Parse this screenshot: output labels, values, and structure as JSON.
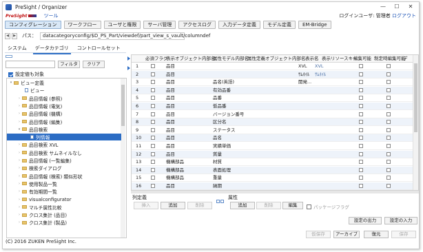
{
  "window": {
    "title": "PreSight / Organizer",
    "controls": [
      "—",
      "☐",
      "✕"
    ]
  },
  "menu": {
    "logo": "PreSight",
    "tools": "ツール",
    "login_prefix": "ログインユーザ: 管理者",
    "logout": "ログアウト"
  },
  "main_tabs": [
    "コンフィグレーション",
    "ワークフロー",
    "ユーザと権限",
    "サーバ管理",
    "アクセスログ",
    "入力データ定義",
    "モデル定義",
    "EM-Bridge"
  ],
  "path": {
    "label": "パス：",
    "value": "datacategoryconfig/$D_PS_Part/viewdef/part_view_s_vault/columndef"
  },
  "sub_tabs": [
    "システム",
    "データカテゴリ",
    "コントロールセット"
  ],
  "left": {
    "filter_label": "フィルタ",
    "clear_label": "クリア",
    "include_settings": "設定値も対象",
    "tree": [
      {
        "label": "ビュー定義",
        "type": "folder",
        "arrow": "▾"
      },
      {
        "label": "ビュー",
        "type": "file",
        "arrow": ""
      },
      {
        "label": "品目情報 (参照)",
        "type": "folder",
        "arrow": "›"
      },
      {
        "label": "品目情報 (電気)",
        "type": "folder",
        "arrow": "›"
      },
      {
        "label": "品目情報 (機構)",
        "type": "folder",
        "arrow": "›"
      },
      {
        "label": "品目情報 (編集)",
        "type": "folder",
        "arrow": "›"
      },
      {
        "label": "品目検索",
        "type": "folder",
        "arrow": "▾"
      },
      {
        "label": "列情報",
        "type": "file",
        "arrow": ""
      },
      {
        "label": "品目検索 XVL",
        "type": "folder",
        "arrow": "›"
      },
      {
        "label": "品目検索 サムネイルなし",
        "type": "folder",
        "arrow": "›"
      },
      {
        "label": "品目情報 (一覧編集)",
        "type": "folder",
        "arrow": "›"
      },
      {
        "label": "検索ダイアログ",
        "type": "folder",
        "arrow": "›"
      },
      {
        "label": "品目情報 (検索) 類似形状",
        "type": "folder",
        "arrow": "›"
      },
      {
        "label": "使用製品一覧",
        "type": "folder",
        "arrow": "›"
      },
      {
        "label": "有効期間一覧",
        "type": "folder",
        "arrow": "›"
      },
      {
        "label": "visualconfigurator",
        "type": "folder",
        "arrow": "›"
      },
      {
        "label": "マルチ属性比較",
        "type": "folder",
        "arrow": "›"
      },
      {
        "label": "クロス集計 (品目)",
        "type": "folder",
        "arrow": "›"
      },
      {
        "label": "クロス集計 (製品)",
        "type": "folder",
        "arrow": "›"
      }
    ],
    "selected_index": 7
  },
  "grid": {
    "headers": [
      "",
      "必須フラグ",
      "表示オブジェクト内部名",
      "属性モデル内部名",
      "属性定義オブジェクト内部名",
      "表示名",
      "表示リソースキー",
      "編集可能",
      "制定時編集可能",
      "デ"
    ],
    "rows": [
      {
        "n": "1",
        "obj": "品目",
        "attr": "",
        "name": "XVL",
        "res": "XVL"
      },
      {
        "n": "2",
        "obj": "品目",
        "attr": "",
        "name": "ｻﾑﾈｲﾙ",
        "res": "ｻﾑﾈｲﾙ"
      },
      {
        "n": "3",
        "obj": "品目",
        "attr": "品名(英語)",
        "name": "開発...",
        "res": ""
      },
      {
        "n": "4",
        "obj": "品目",
        "attr": "有効品番",
        "name": "",
        "res": ""
      },
      {
        "n": "5",
        "obj": "品目",
        "attr": "品番",
        "name": "",
        "res": ""
      },
      {
        "n": "6",
        "obj": "品目",
        "attr": "仮品番",
        "name": "",
        "res": ""
      },
      {
        "n": "7",
        "obj": "品目",
        "attr": "バージョン番号",
        "name": "",
        "res": ""
      },
      {
        "n": "8",
        "obj": "品目",
        "attr": "区分名",
        "name": "",
        "res": ""
      },
      {
        "n": "9",
        "obj": "品目",
        "attr": "ステータス",
        "name": "",
        "res": ""
      },
      {
        "n": "10",
        "obj": "品目",
        "attr": "品名",
        "name": "",
        "res": ""
      },
      {
        "n": "11",
        "obj": "品目",
        "attr": "実績単価",
        "name": "",
        "res": ""
      },
      {
        "n": "12",
        "obj": "品目",
        "attr": "質量",
        "name": "",
        "res": ""
      },
      {
        "n": "13",
        "obj": "機構部品",
        "attr": "材質",
        "name": "",
        "res": ""
      },
      {
        "n": "14",
        "obj": "機構部品",
        "attr": "表面処理",
        "name": "",
        "res": ""
      },
      {
        "n": "15",
        "obj": "機構部品",
        "attr": "重量",
        "name": "",
        "res": ""
      },
      {
        "n": "16",
        "obj": "品目",
        "attr": "納期",
        "name": "",
        "res": ""
      }
    ]
  },
  "column_group": {
    "label": "列定義",
    "insert": "挿入",
    "add": "追加",
    "delete": "削除"
  },
  "attr_group": {
    "label": "属性",
    "add": "追加",
    "delete": "削除",
    "edit": "編集",
    "package_flag": "パッケージフラグ"
  },
  "config_buttons": {
    "export": "設定の出力",
    "import": "設定の入力"
  },
  "bottom_buttons": {
    "temp_save": "仮保存",
    "archive": "アーカイブ",
    "restore": "復元",
    "save": "保存"
  },
  "footer": "(C) 2016 ZUKEN PreSight Inc."
}
